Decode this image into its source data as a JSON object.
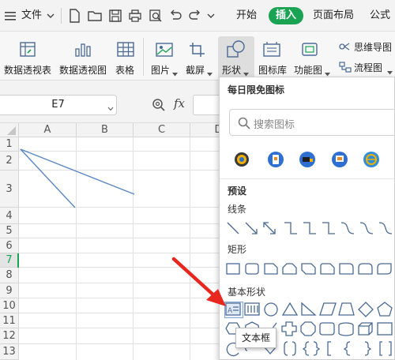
{
  "menubar": {
    "file_label": "文件",
    "tabs": [
      {
        "label": "开始"
      },
      {
        "label": "插入"
      },
      {
        "label": "页面布局"
      },
      {
        "label": "公式"
      }
    ]
  },
  "ribbon": {
    "items": [
      {
        "label": "数据透视表",
        "icon": "pivot-table-icon"
      },
      {
        "label": "数据透视图",
        "icon": "pivot-chart-icon"
      },
      {
        "label": "表格",
        "icon": "table-icon"
      },
      {
        "label": "图片",
        "icon": "picture-icon"
      },
      {
        "label": "截屏",
        "icon": "screenshot-icon"
      },
      {
        "label": "形状",
        "icon": "shape-icon"
      },
      {
        "label": "图标库",
        "icon": "icon-library-icon"
      },
      {
        "label": "功能图",
        "icon": "function-chart-icon"
      },
      {
        "label": "思维导图",
        "icon": "mind-map-icon"
      },
      {
        "label": "流程图",
        "icon": "flowchart-icon"
      }
    ]
  },
  "formula": {
    "cell_ref": "E7",
    "fx_label": "fx"
  },
  "sheet": {
    "columns": [
      "A",
      "B",
      "C",
      "D"
    ],
    "rows": [
      "1",
      "2",
      "3",
      "4",
      "5",
      "6",
      "7",
      "8",
      "9",
      "10",
      "11",
      "12",
      "13"
    ]
  },
  "panel": {
    "daily_title": "每日限免图标",
    "search_placeholder": "搜索图标",
    "preset_title": "预设",
    "lines_title": "线条",
    "rect_title": "矩形",
    "basic_title": "基本形状"
  },
  "tooltip": {
    "text": "文本框"
  },
  "colors": {
    "accent_green": "#1aa352",
    "line_blue": "#5b87c5",
    "arrow_red": "#e8271f",
    "shape_stroke": "#4a6a95"
  }
}
